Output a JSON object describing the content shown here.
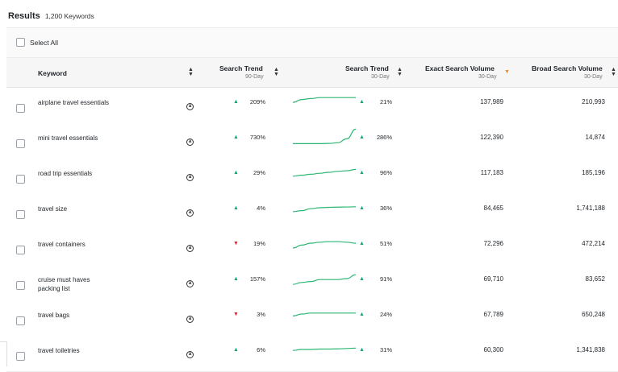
{
  "results": {
    "title": "Results",
    "count": "1,200 Keywords"
  },
  "select_all": {
    "label": "Select All"
  },
  "columns": {
    "keyword": {
      "label": "Keyword"
    },
    "trend90": {
      "label": "Search Trend",
      "sub": "90-Day"
    },
    "trend30": {
      "label": "Search Trend",
      "sub": "30-Day"
    },
    "exact": {
      "label": "Exact Search Volume",
      "sub": "30-Day"
    },
    "broad": {
      "label": "Broad Search Volume",
      "sub": "30-Day"
    }
  },
  "icons": {
    "info": "a",
    "sort": "sort-icon",
    "sort_active": "sort-desc-icon"
  },
  "colors": {
    "up": "#17a673",
    "down": "#d8282f",
    "sparkline": "#2bb673",
    "sort_active": "#f08a24"
  },
  "rows": [
    {
      "keyword": "airplane travel essentials",
      "trend90_dir": "up",
      "trend90": "209%",
      "trend30_dir": "up",
      "trend30": "21%",
      "exact": "137,989",
      "broad": "210,993",
      "spark": [
        0.55,
        0.4,
        0.35,
        0.3,
        0.3,
        0.3,
        0.3,
        0.3
      ]
    },
    {
      "keyword": "mini travel essentials",
      "trend90_dir": "up",
      "trend90": "730%",
      "trend30_dir": "up",
      "trend30": "286%",
      "exact": "122,390",
      "broad": "14,874",
      "spark": [
        0.85,
        0.85,
        0.85,
        0.85,
        0.84,
        0.8,
        0.6,
        0.1
      ]
    },
    {
      "keyword": "road trip essentials",
      "trend90_dir": "up",
      "trend90": "29%",
      "trend30_dir": "up",
      "trend30": "96%",
      "exact": "117,183",
      "broad": "185,196",
      "spark": [
        0.7,
        0.65,
        0.6,
        0.55,
        0.5,
        0.45,
        0.42,
        0.35
      ]
    },
    {
      "keyword": "travel size",
      "trend90_dir": "up",
      "trend90": "4%",
      "trend30_dir": "up",
      "trend30": "36%",
      "exact": "84,465",
      "broad": "1,741,188",
      "spark": [
        0.7,
        0.65,
        0.55,
        0.5,
        0.48,
        0.47,
        0.46,
        0.45
      ]
    },
    {
      "keyword": "travel containers",
      "trend90_dir": "down",
      "trend90": "19%",
      "trend30_dir": "up",
      "trend30": "51%",
      "exact": "72,296",
      "broad": "472,214",
      "spark": [
        0.75,
        0.6,
        0.5,
        0.45,
        0.42,
        0.42,
        0.45,
        0.5
      ]
    },
    {
      "keyword": "cruise must haves packing list",
      "trend90_dir": "up",
      "trend90": "157%",
      "trend30_dir": "up",
      "trend30": "91%",
      "exact": "69,710",
      "broad": "83,652",
      "spark": [
        0.8,
        0.7,
        0.65,
        0.55,
        0.55,
        0.55,
        0.5,
        0.3
      ]
    },
    {
      "keyword": "travel bags",
      "trend90_dir": "down",
      "trend90": "3%",
      "trend30_dir": "up",
      "trend30": "24%",
      "exact": "67,789",
      "broad": "650,248",
      "spark": [
        0.6,
        0.5,
        0.45,
        0.45,
        0.45,
        0.45,
        0.45,
        0.45
      ]
    },
    {
      "keyword": "travel toiletries",
      "trend90_dir": "up",
      "trend90": "6%",
      "trend30_dir": "up",
      "trend30": "31%",
      "exact": "60,300",
      "broad": "1,341,838",
      "spark": [
        0.55,
        0.5,
        0.5,
        0.48,
        0.48,
        0.47,
        0.45,
        0.43
      ]
    }
  ]
}
